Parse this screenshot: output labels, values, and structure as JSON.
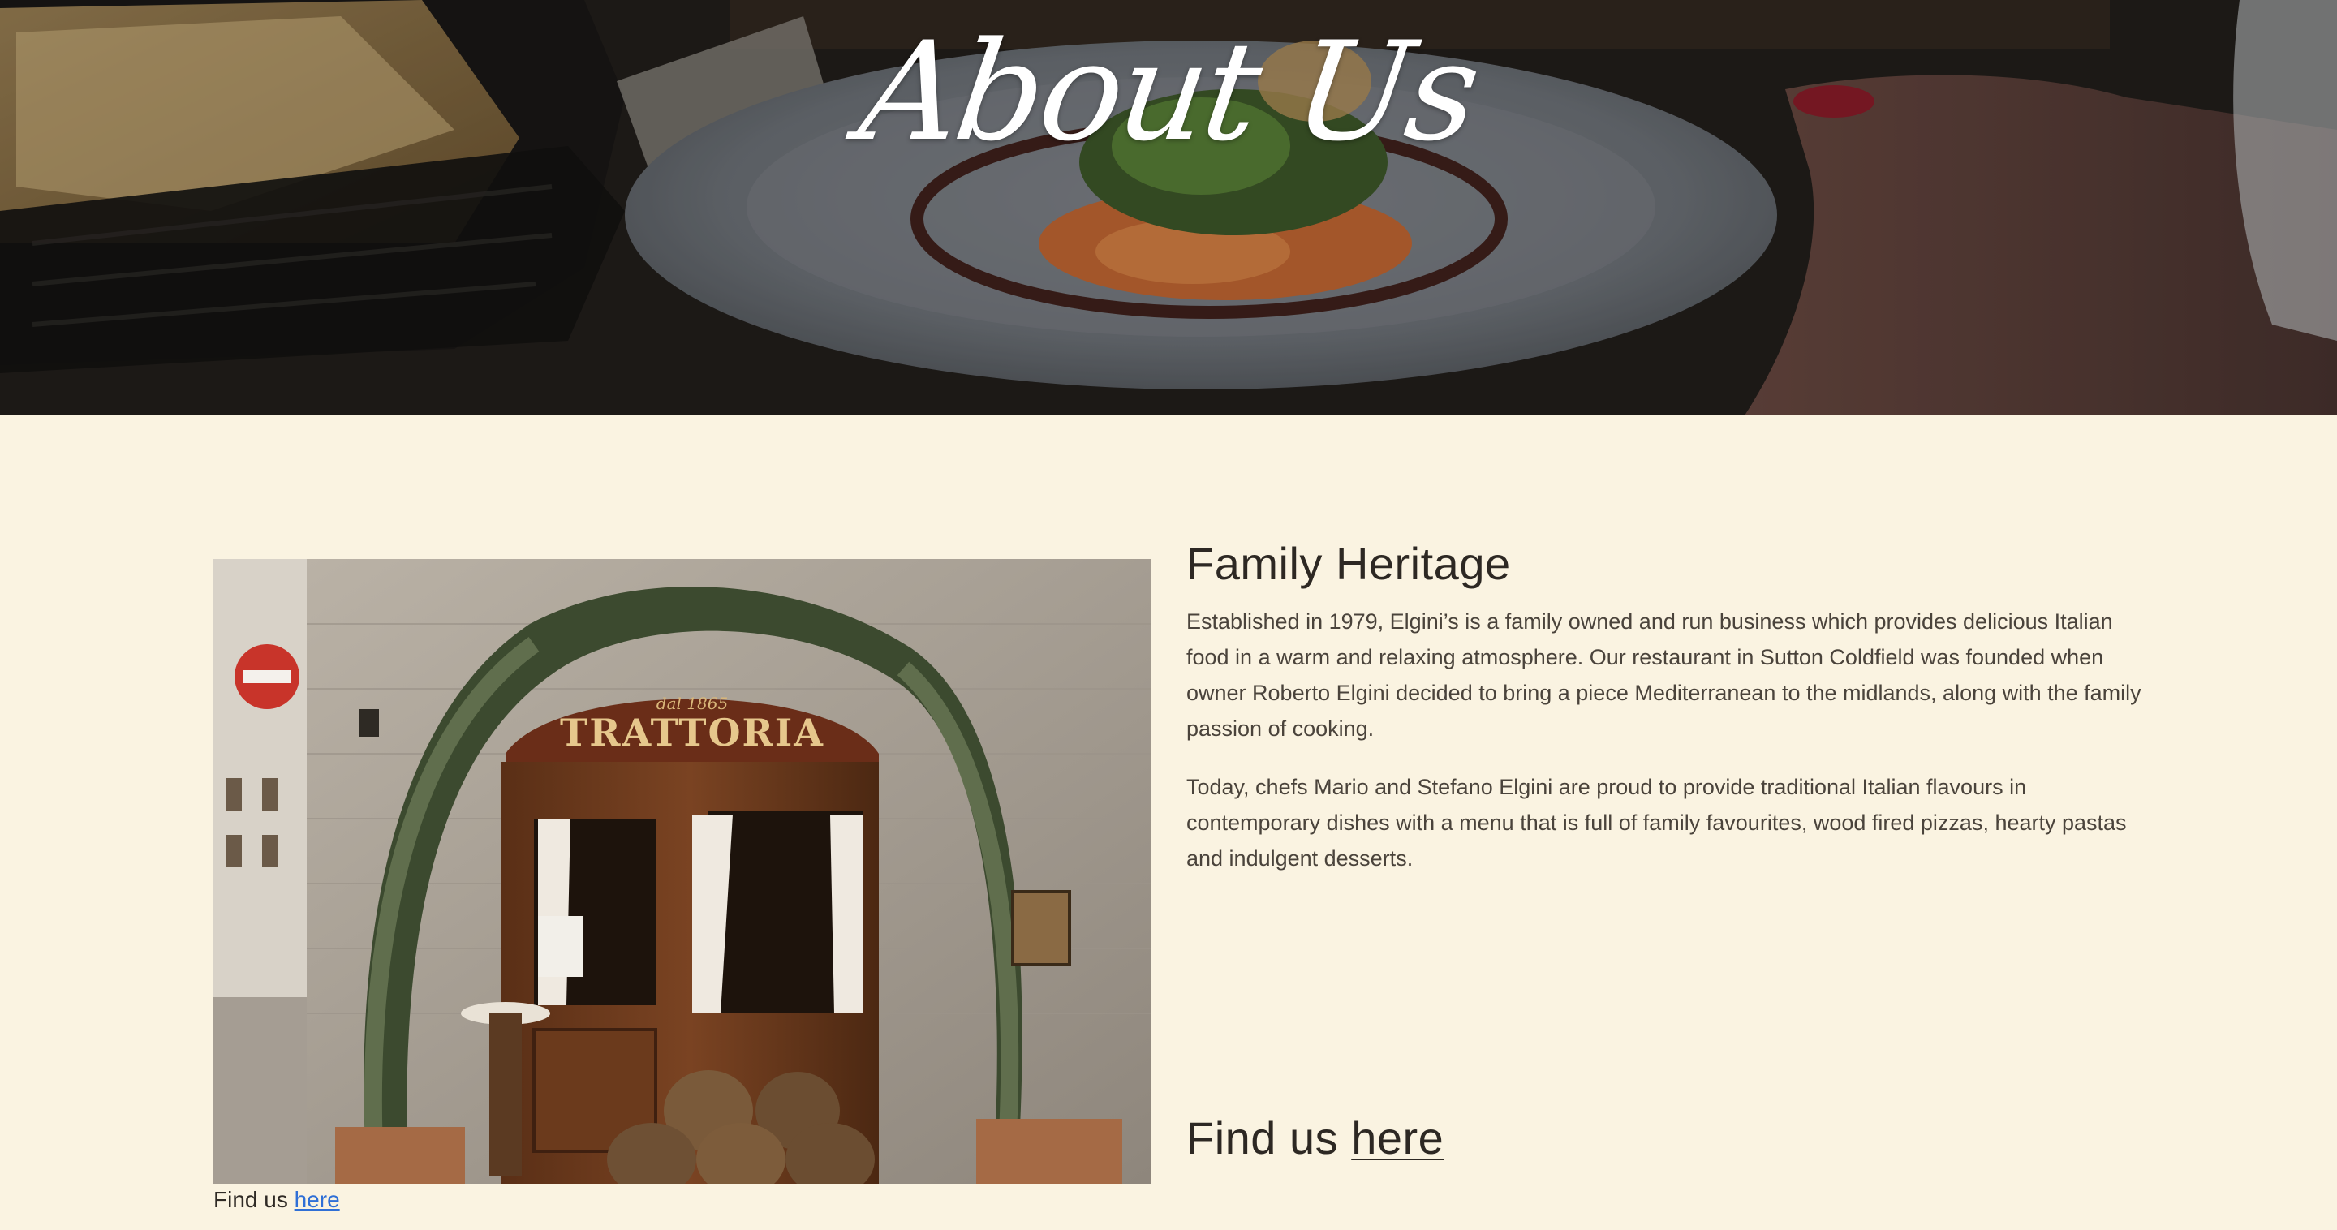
{
  "hero": {
    "title": "About Us"
  },
  "about": {
    "heading": "Family Heritage",
    "paragraphs": [
      "Established in 1979, Elgini’s is a family owned and run business which provides delicious Italian food in a warm and relaxing atmosphere. Our restaurant in Sutton Coldfield was founded when owner Roberto Elgini decided to bring a piece Mediterranean to the midlands, along with the family passion of cooking.",
      "Today, chefs Mario and Stefano Elgini are proud to provide traditional Italian flavours in contemporary dishes with a menu that is full of family favourites, wood fired pizzas, hearty pastas and indulgent desserts."
    ],
    "photo": {
      "sign_small": "dal 1865",
      "sign_main": "TRATTORIA"
    },
    "caption": {
      "prefix": "Find us",
      "link": "here"
    },
    "find_us": {
      "prefix": "Find us",
      "link": "here"
    }
  },
  "colors": {
    "page_background": "#faf3e1",
    "caption_link": "#2f6fd6",
    "text": "#2d2823"
  }
}
